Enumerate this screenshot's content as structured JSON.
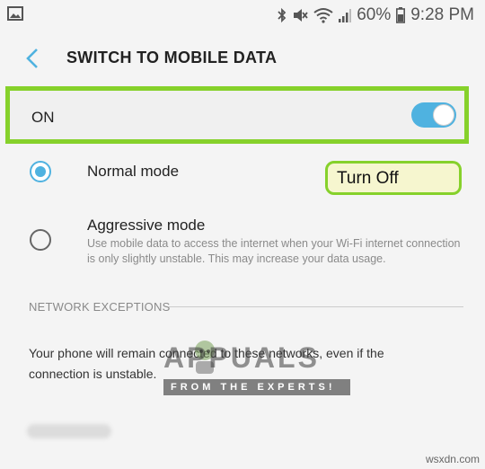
{
  "status_bar": {
    "battery_percent": "60%",
    "time": "9:28 PM"
  },
  "header": {
    "title": "SWITCH TO MOBILE DATA"
  },
  "master_switch": {
    "label": "ON",
    "enabled": true
  },
  "options": [
    {
      "title": "Normal mode",
      "description": "",
      "selected": true
    },
    {
      "title": "Aggressive mode",
      "description": "Use mobile data to access the internet when your Wi-Fi internet connection is only slightly unstable. This may increase your data usage.",
      "selected": false
    }
  ],
  "annotation": {
    "text": "Turn Off"
  },
  "network_exceptions": {
    "header": "NETWORK EXCEPTIONS",
    "description": "Your phone will remain connected to these networks, even if the connection is unstable."
  },
  "watermark": {
    "title": "APPUALS",
    "subtitle": "FROM THE EXPERTS!"
  },
  "corner_text": "wsxdn.com",
  "colors": {
    "accent": "#4fb2e0",
    "highlight": "#86d12b",
    "annotation_bg": "#f6f6cf"
  }
}
